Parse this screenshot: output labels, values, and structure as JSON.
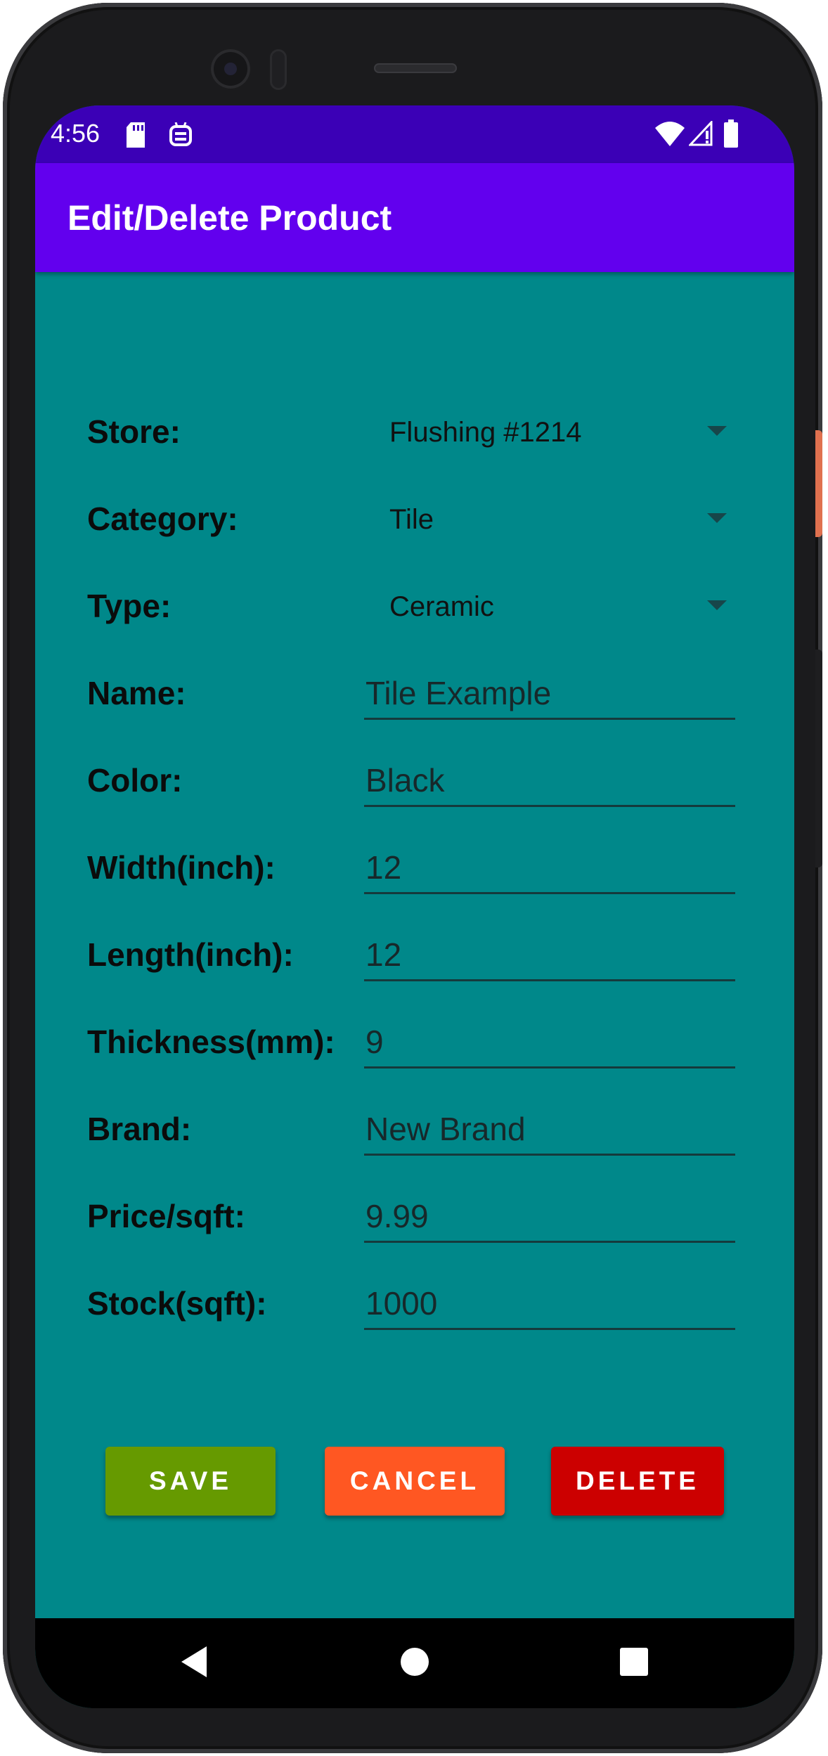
{
  "status_bar": {
    "time": "4:56",
    "icons": [
      "sd-card-icon",
      "robot-notification-icon",
      "wifi-icon",
      "cell-signal-icon",
      "battery-icon"
    ]
  },
  "app_bar": {
    "title": "Edit/Delete Product"
  },
  "form": {
    "store": {
      "label": "Store:",
      "value": "Flushing #1214"
    },
    "category": {
      "label": "Category:",
      "value": "Tile"
    },
    "type": {
      "label": "Type:",
      "value": "Ceramic"
    },
    "name": {
      "label": "Name:",
      "value": "Tile Example"
    },
    "color": {
      "label": "Color:",
      "value": "Black"
    },
    "width": {
      "label": "Width(inch):",
      "value": "12"
    },
    "length": {
      "label": "Length(inch):",
      "value": "12"
    },
    "thickness": {
      "label": "Thickness(mm):",
      "value": "9"
    },
    "brand": {
      "label": "Brand:",
      "value": "New Brand"
    },
    "price": {
      "label": "Price/sqft:",
      "value": "9.99"
    },
    "stock": {
      "label": "Stock(sqft):",
      "value": "1000"
    }
  },
  "buttons": {
    "save": "SAVE",
    "cancel": "CANCEL",
    "delete": "DELETE"
  },
  "colors": {
    "status_bar": "#3b00b6",
    "app_bar": "#6200ee",
    "background": "#00888a",
    "save": "#669a00",
    "cancel": "#ff5722",
    "delete": "#cc0000"
  },
  "nav_bar": {
    "icons": [
      "back-icon",
      "home-icon",
      "recent-apps-icon"
    ]
  }
}
